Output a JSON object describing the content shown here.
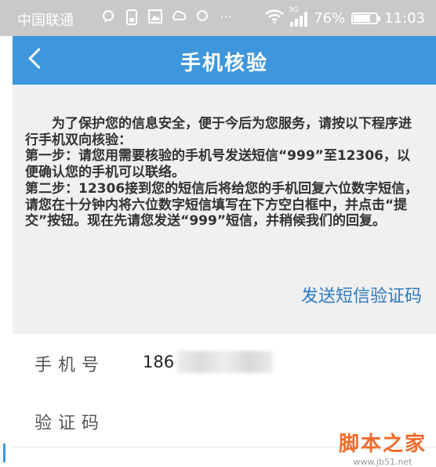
{
  "status_bar": {
    "carrier": "中国联通",
    "network_tag": "3G",
    "battery": "76%",
    "battery_level": 0.76,
    "time": "11:03",
    "icons": [
      "chat-icon",
      "phone-icon",
      "image-icon",
      "cloud-icon",
      "circle-icon",
      "more-icon"
    ]
  },
  "header": {
    "title": "手机核验",
    "back_icon": "chevron-left-icon"
  },
  "content": {
    "instructions": "　　为了保护您的信息安全，便于今后为您服务，请按以下程序进行手机双向核验：\n第一步：请您用需要核验的手机号发送短信“999”至12306，以便确认您的手机可以联络。\n第二步：12306接到您的短信后将给您的手机回复六位数字短信，请您在十分钟内将六位数字短信填写在下方空白框中，并点击“提交”按钮。现在先请您发送“999”短信，并稍候我们的回复。",
    "send_sms_label": "发送短信验证码"
  },
  "form": {
    "phone_label": "手机号",
    "phone_value": "186",
    "code_label": "验证码"
  },
  "watermark": {
    "logo": "脚本之家",
    "url": "www.jb51.net"
  },
  "colors": {
    "header_bg": "#3e97dc",
    "link": "#2b7ac0",
    "status_bar_bg": "#c9c9c9"
  }
}
